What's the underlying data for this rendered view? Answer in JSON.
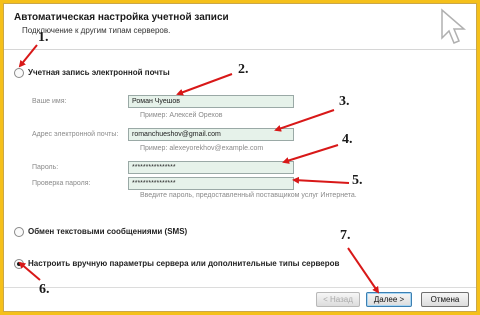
{
  "header": {
    "title": "Автоматическая настройка учетной записи",
    "subtitle": "Подключение к другим типам серверов."
  },
  "options": {
    "email_account": "Учетная запись электронной почты",
    "sms": "Обмен текстовыми сообщениями (SMS)",
    "manual": "Настроить вручную параметры сервера или дополнительные типы серверов"
  },
  "form": {
    "name_label": "Ваше имя:",
    "name_value": "Роман Чуешов",
    "name_hint": "Пример: Алексей Орехов",
    "email_label": "Адрес электронной почты:",
    "email_value": "romanchueshov@gmail.com",
    "email_hint": "Пример: alexeyorekhov@example.com",
    "password_label": "Пароль:",
    "password_value": "****************",
    "confirm_label": "Проверка пароля:",
    "confirm_value": "****************",
    "password_hint": "Введите пароль, предоставленный поставщиком услуг Интернета."
  },
  "buttons": {
    "back": "< Назад",
    "next": "Далее >",
    "cancel": "Отмена"
  },
  "annotations": [
    "1.",
    "2.",
    "3.",
    "4.",
    "5.",
    "6.",
    "7."
  ],
  "colors": {
    "frame": "#f5c01a",
    "arrow": "#d81818",
    "field_bg": "#e6f2ea"
  }
}
